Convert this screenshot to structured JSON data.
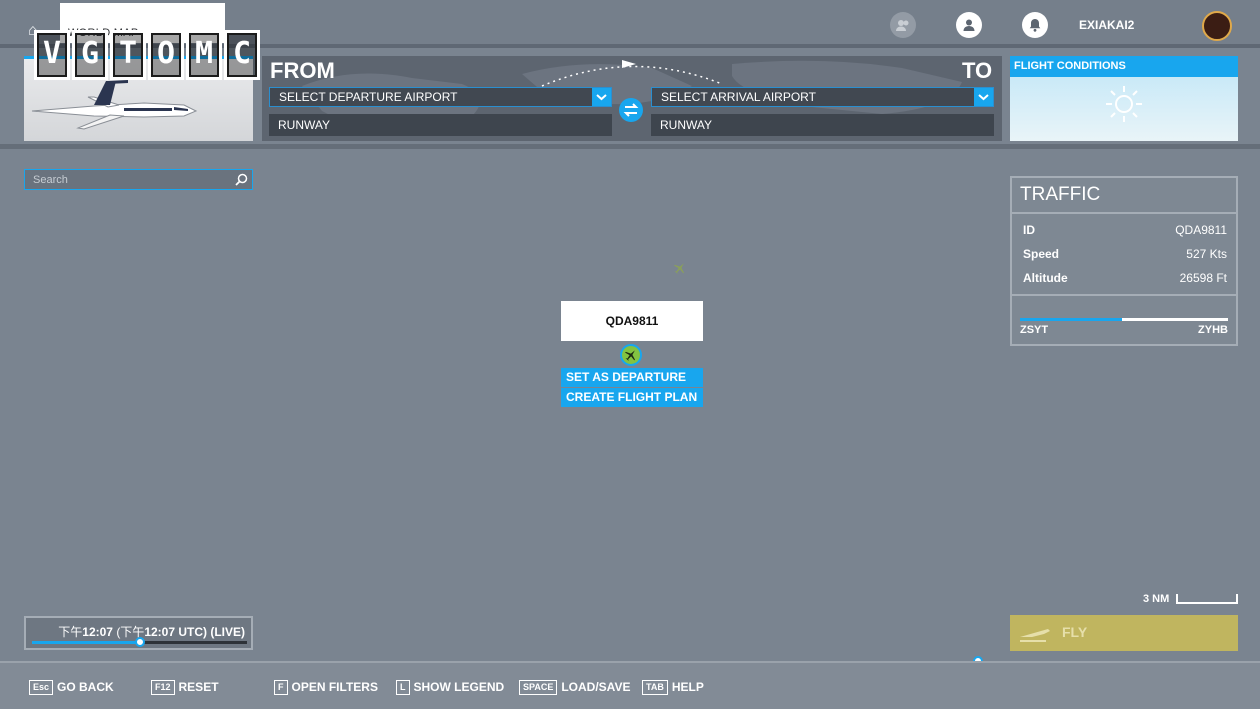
{
  "header": {
    "breadcrumb": "WORLD MAP",
    "username": "EXIAKAI2"
  },
  "watermark": "VGTOMC",
  "route": {
    "from_label": "FROM",
    "to_label": "TO",
    "departure_placeholder": "SELECT DEPARTURE AIRPORT",
    "arrival_placeholder": "SELECT ARRIVAL AIRPORT",
    "departure_runway": "RUNWAY",
    "arrival_runway": "RUNWAY"
  },
  "conditions": {
    "title": "FLIGHT CONDITIONS",
    "weather_icon": "sun-icon"
  },
  "search": {
    "placeholder": "Search"
  },
  "traffic": {
    "title": "TRAFFIC",
    "rows": [
      {
        "key": "ID",
        "value": "QDA9811"
      },
      {
        "key": "Speed",
        "value": "527 Kts"
      },
      {
        "key": "Altitude",
        "value": "26598 Ft"
      }
    ],
    "origin": "ZSYT",
    "destination": "ZYHB",
    "progress": 0.49
  },
  "popup": {
    "callsign": "QDA9811",
    "menu": [
      "SET AS DEPARTURE",
      "CREATE FLIGHT PLAN"
    ]
  },
  "map": {
    "scale_label": "3 NM"
  },
  "time": {
    "label_prefix": "下午",
    "local": "12:07",
    "label_mid": "(下午",
    "utc": "12:07 UTC) (LIVE)",
    "slider_fraction": 0.5
  },
  "fly_label": "FLY",
  "footer": [
    {
      "key": "Esc",
      "label": "GO BACK"
    },
    {
      "key": "F12",
      "label": "RESET"
    },
    {
      "key": "F",
      "label": "OPEN FILTERS"
    },
    {
      "key": "L",
      "label": "SHOW LEGEND"
    },
    {
      "key": "SPACE",
      "label": "LOAD/SAVE"
    },
    {
      "key": "TAB",
      "label": "HELP"
    }
  ],
  "colors": {
    "accent": "#18a6ee",
    "map_background": "#7a8490",
    "fly_button": "#c0b55f"
  }
}
